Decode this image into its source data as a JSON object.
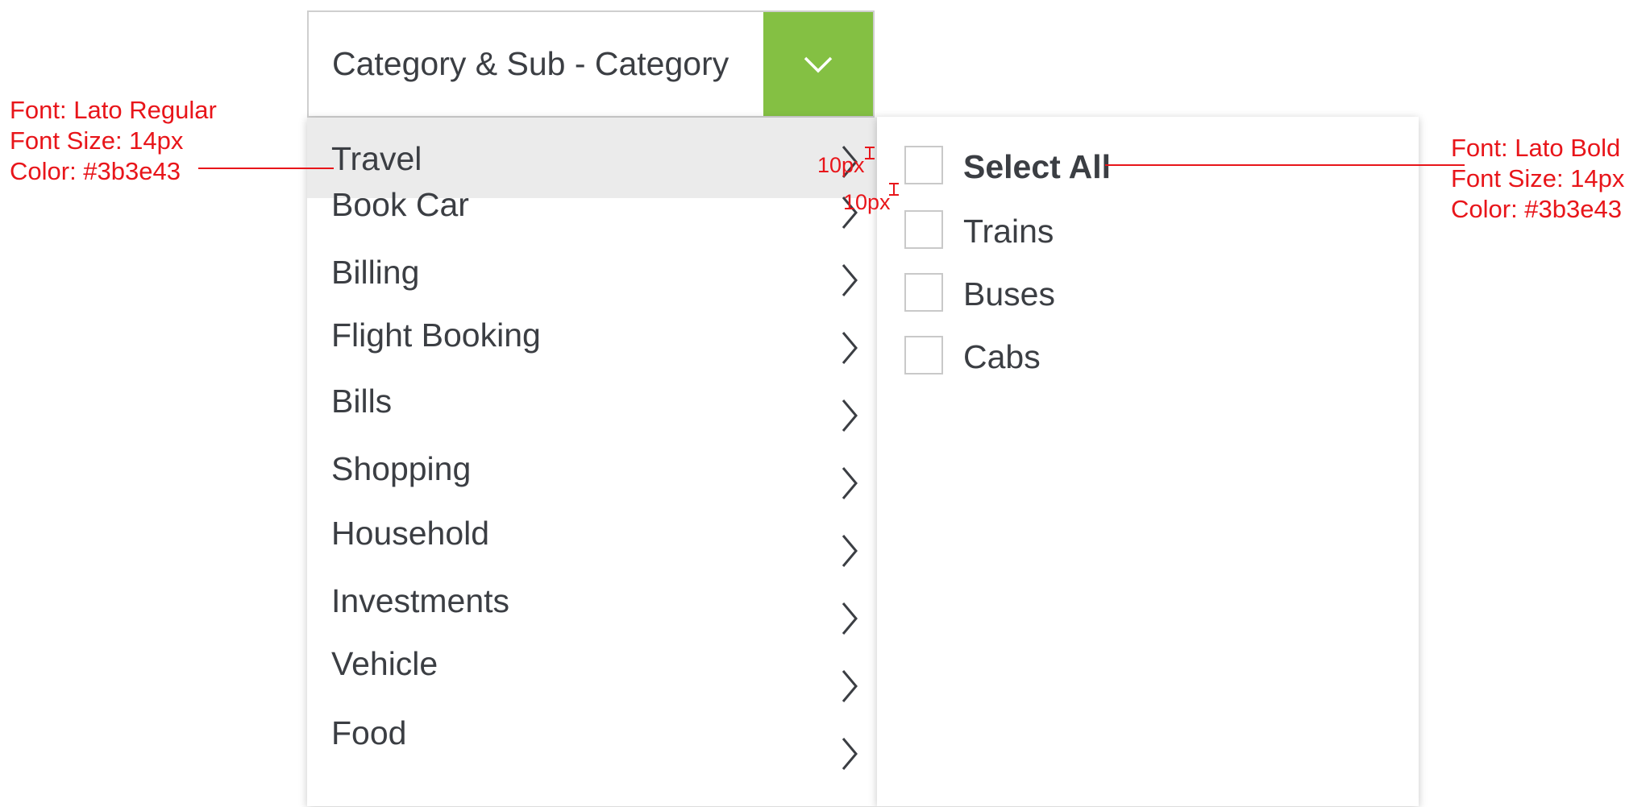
{
  "dropdown": {
    "label": "Category & Sub - Category",
    "toggle_icon": "chevron-down-icon",
    "accent_color": "#84c043"
  },
  "categories": [
    {
      "label": "Travel",
      "active": true
    },
    {
      "label": "Book Car"
    },
    {
      "label": "Billing"
    },
    {
      "label": "Flight Booking"
    },
    {
      "label": "Bills"
    },
    {
      "label": "Shopping"
    },
    {
      "label": "Household"
    },
    {
      "label": "Investments"
    },
    {
      "label": "Vehicle"
    },
    {
      "label": "Food"
    }
  ],
  "subcategories": [
    {
      "label": "Select All",
      "bold": true,
      "checked": false
    },
    {
      "label": "Trains",
      "checked": false
    },
    {
      "label": "Buses",
      "checked": false
    },
    {
      "label": "Cabs",
      "checked": false
    }
  ],
  "annotations": {
    "left": {
      "font": "Font: Lato Regular",
      "size": "Font Size: 14px",
      "color": "Color: #3b3e43"
    },
    "right": {
      "font": "Font: Lato Bold",
      "size": "Font Size: 14px",
      "color": "Color: #3b3e43"
    },
    "spacing_1": "10px",
    "spacing_2": "10px",
    "annotation_color": "#e8151a",
    "text_color": "#3b3e43",
    "hover_background": "#ebebeb"
  }
}
